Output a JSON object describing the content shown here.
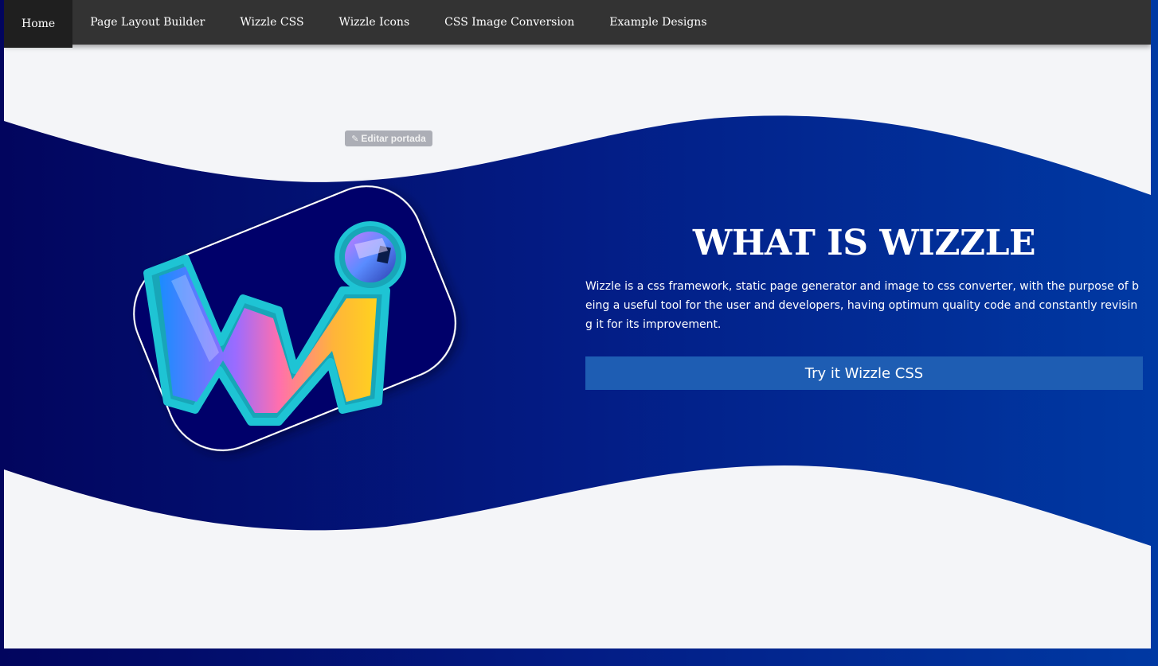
{
  "nav": {
    "items": [
      {
        "label": "Home",
        "active": true
      },
      {
        "label": "Page Layout Builder",
        "active": false
      },
      {
        "label": "Wizzle CSS",
        "active": false
      },
      {
        "label": "Wizzle Icons",
        "active": false
      },
      {
        "label": "CSS Image Conversion",
        "active": false
      },
      {
        "label": "Example Designs",
        "active": false
      }
    ]
  },
  "hero": {
    "edit_cover_label": "Editar portada",
    "title": "WHAT IS WIZZLE",
    "description": "Wizzle is a css framework, static page generator and image to css converter, with the purpose of being a useful tool for the user and developers, having optimum quality code and constantly revising it for its improvement.",
    "cta_label": "Try it Wizzle CSS"
  },
  "colors": {
    "navbar": "#333333",
    "nav_active": "#1f1f1f",
    "page_background": "#f4f5f8",
    "wave_gradient_start": "#02055e",
    "wave_gradient_end": "#0039a3",
    "cta_background": "#1e5db3"
  },
  "icons": {
    "edit": "pencil-icon",
    "logo": "wizzle-logo"
  }
}
